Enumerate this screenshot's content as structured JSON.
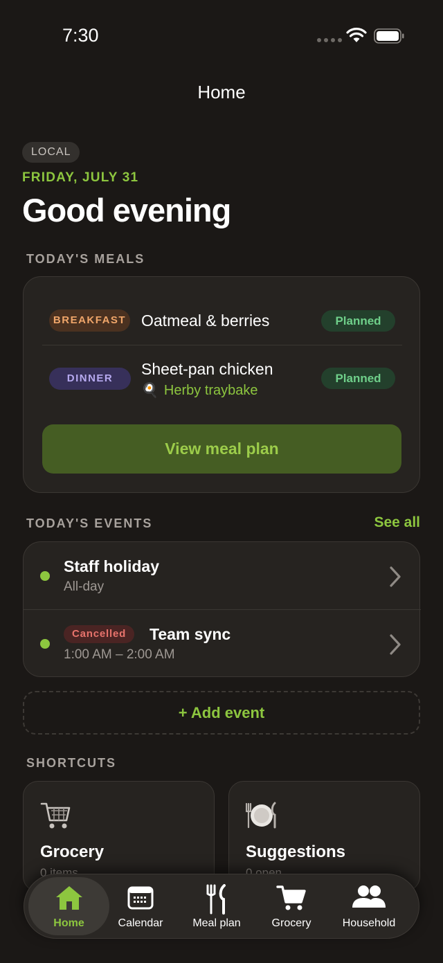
{
  "status_bar": {
    "time": "7:30"
  },
  "nav": {
    "title": "Home"
  },
  "header": {
    "badge": "LOCAL",
    "date": "FRIDAY, JULY 31",
    "greeting": "Good evening"
  },
  "meals": {
    "section_label": "TODAY'S MEALS",
    "items": [
      {
        "tag": "BREAKFAST",
        "name": "Oatmeal & berries",
        "status": "Planned"
      },
      {
        "tag": "DINNER",
        "name": "Sheet-pan chicken",
        "subtitle": "Herby traybake",
        "status": "Planned"
      }
    ],
    "button_label": "View meal plan"
  },
  "events": {
    "section_label": "TODAY'S EVENTS",
    "see_all_label": "See all",
    "items": [
      {
        "title": "Staff holiday",
        "time": "All-day"
      },
      {
        "tag": "Cancelled",
        "title": "Team sync",
        "time": "1:00 AM – 2:00 AM"
      }
    ],
    "add_label": "+ Add event"
  },
  "shortcuts": {
    "section_label": "SHORTCUTS",
    "items": [
      {
        "title": "Grocery",
        "subtitle": "0 items",
        "icon": "shopping-cart-icon"
      },
      {
        "title": "Suggestions",
        "subtitle": "0 open",
        "icon": "plate-cutlery-icon"
      }
    ]
  },
  "tab_bar": {
    "active": "Home",
    "tabs": [
      {
        "label": "Home",
        "icon": "home-icon"
      },
      {
        "label": "Calendar",
        "icon": "calendar-icon"
      },
      {
        "label": "Meal plan",
        "icon": "fork-knife-icon"
      },
      {
        "label": "Grocery",
        "icon": "cart-icon"
      },
      {
        "label": "Household",
        "icon": "people-icon"
      }
    ]
  },
  "colors": {
    "background": "#1b1816",
    "accent": "#8dc63f",
    "card": "#262320",
    "planned": "#6fcf8a",
    "cancelled": "#e8736c"
  }
}
